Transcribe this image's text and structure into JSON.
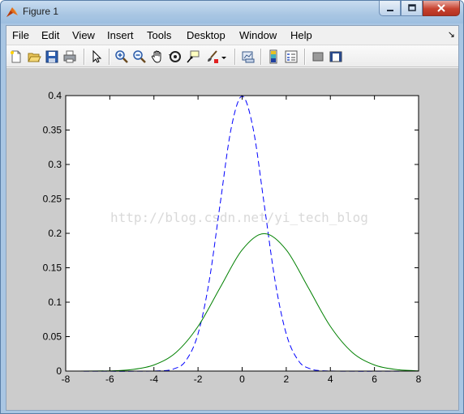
{
  "window": {
    "title": "Figure 1",
    "minimize_glyph": "▁",
    "maximize_glyph": "□",
    "close_glyph": "✕"
  },
  "menu": {
    "items": [
      "File",
      "Edit",
      "View",
      "Insert",
      "Tools",
      "Desktop",
      "Window",
      "Help"
    ],
    "dock_arrow": "↘"
  },
  "toolbar": {
    "icons": [
      "new-figure-icon",
      "open-file-icon",
      "save-icon",
      "print-icon",
      "edit-plot-arrow-icon",
      "zoom-in-icon",
      "zoom-out-icon",
      "pan-hand-icon",
      "rotate-3d-icon",
      "data-cursor-icon",
      "brush-icon",
      "brush-dropdown-icon",
      "link-plot-icon",
      "insert-colorbar-icon",
      "insert-legend-icon",
      "hide-plot-tools-icon",
      "show-plot-tools-icon"
    ]
  },
  "colors": {
    "background": "#cccccc",
    "axes_bg": "#ffffff",
    "series_dashed": "#0000ff",
    "series_solid": "#008000"
  },
  "watermark": "http://blog.csdn.net/yi_tech_blog",
  "chart_data": {
    "type": "line",
    "xlim": [
      -8,
      8
    ],
    "ylim": [
      0,
      0.4
    ],
    "x_ticks": [
      -8,
      -6,
      -4,
      -2,
      0,
      2,
      4,
      6,
      8
    ],
    "y_ticks": [
      0,
      0.05,
      0.1,
      0.15,
      0.2,
      0.25,
      0.3,
      0.35,
      0.4
    ],
    "x_tick_labels": [
      "-8",
      "-6",
      "-4",
      "-2",
      "0",
      "2",
      "4",
      "6",
      "8"
    ],
    "y_tick_labels": [
      "0",
      "0.05",
      "0.1",
      "0.15",
      "0.2",
      "0.25",
      "0.3",
      "0.35",
      "0.4"
    ],
    "grid": false,
    "title": "",
    "xlabel": "",
    "ylabel": "",
    "series": [
      {
        "style": "dashed",
        "color": "#0000ff",
        "x": [
          -8,
          -4,
          -3,
          -2.5,
          -2,
          -1.5,
          -1,
          -0.5,
          0,
          0.5,
          1,
          1.5,
          2,
          2.5,
          3,
          4,
          8
        ],
        "y": [
          0,
          0.0001,
          0.0044,
          0.0175,
          0.054,
          0.1295,
          0.242,
          0.352,
          0.399,
          0.352,
          0.242,
          0.1295,
          0.054,
          0.0175,
          0.0044,
          0.0001,
          0
        ]
      },
      {
        "style": "solid",
        "color": "#008000",
        "x": [
          -8,
          -6,
          -5,
          -4,
          -3,
          -2,
          -1,
          0,
          1,
          2,
          3,
          4,
          5,
          6,
          7,
          8
        ],
        "y": [
          0.0,
          0.0004,
          0.0022,
          0.0088,
          0.027,
          0.0648,
          0.121,
          0.176,
          0.1995,
          0.176,
          0.121,
          0.0648,
          0.027,
          0.0088,
          0.0022,
          0.0004
        ]
      }
    ]
  }
}
